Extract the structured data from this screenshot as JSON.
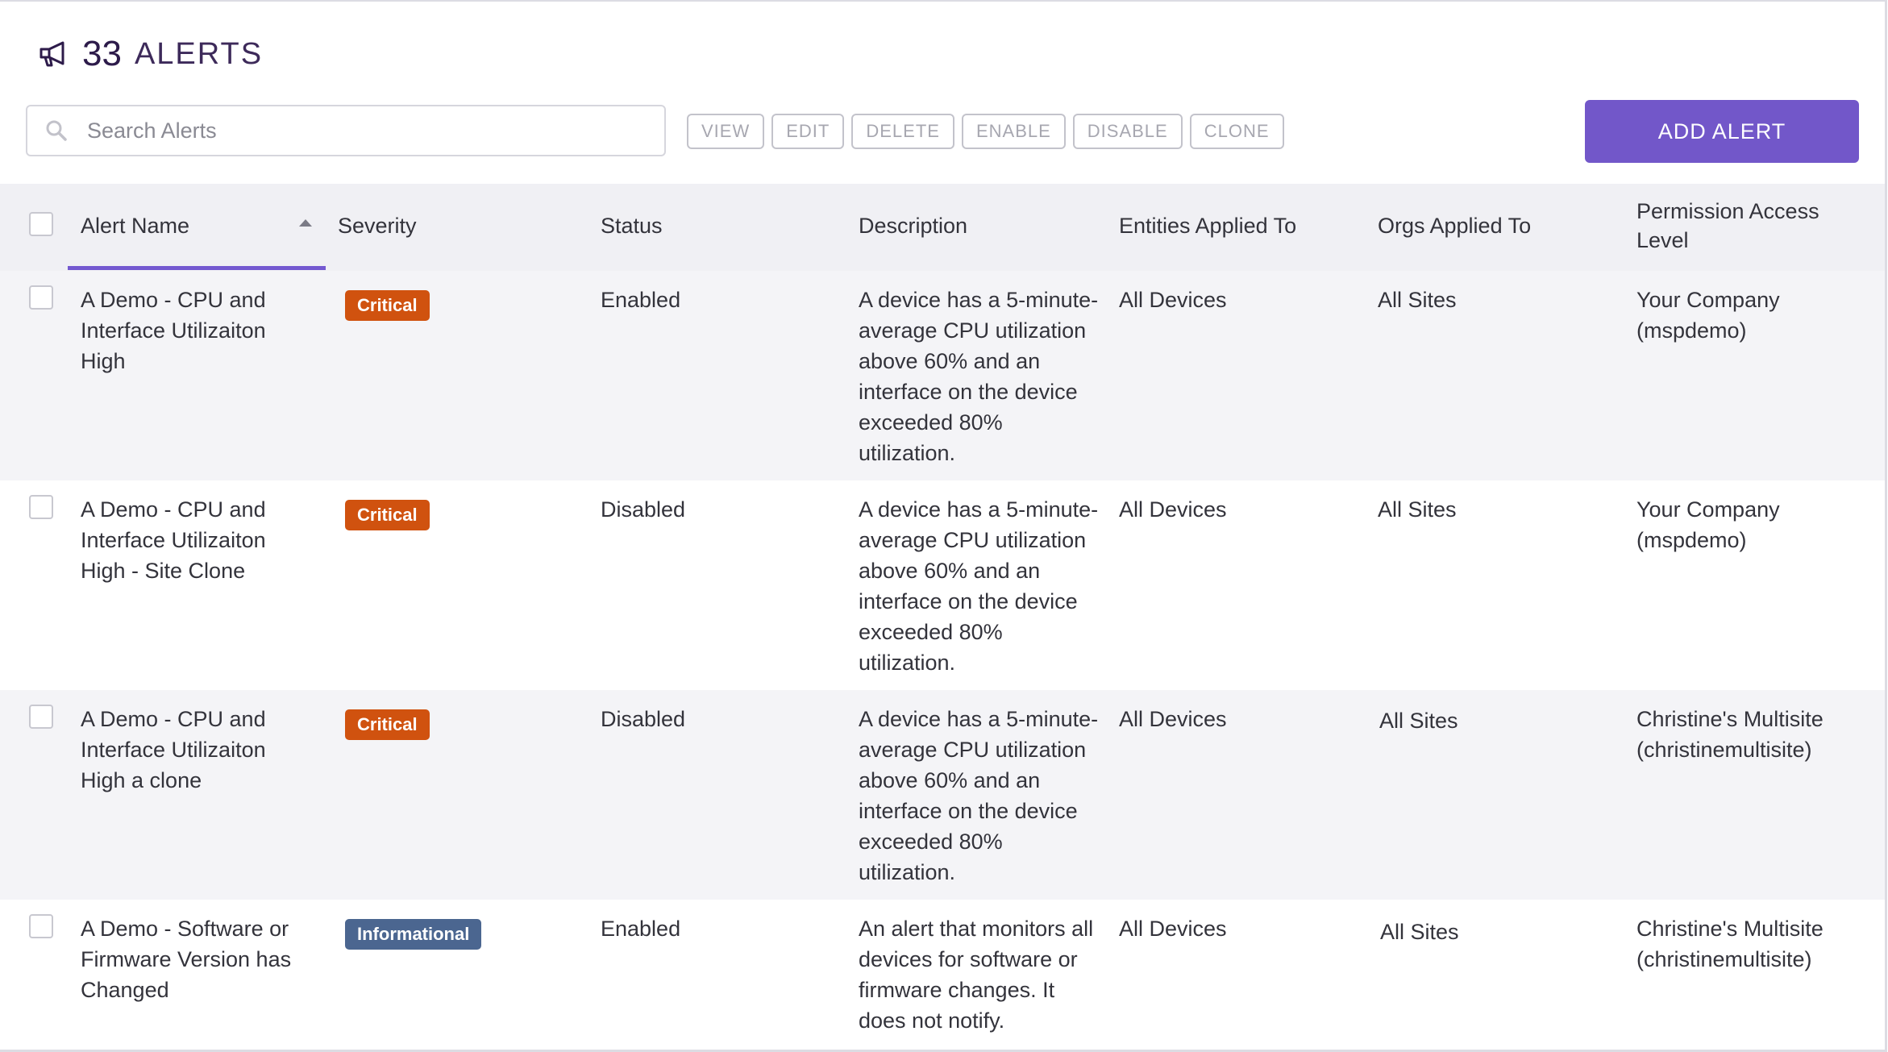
{
  "header": {
    "count": "33",
    "title": "ALERTS",
    "icon": "megaphone-icon"
  },
  "search": {
    "placeholder": "Search Alerts",
    "value": ""
  },
  "actions": {
    "view": "VIEW",
    "edit": "EDIT",
    "delete": "DELETE",
    "enable": "ENABLE",
    "disable": "DISABLE",
    "clone": "CLONE"
  },
  "add_button": "ADD ALERT",
  "colors": {
    "accent": "#7257c9",
    "critical": "#d0520f",
    "informational": "#4b6690"
  },
  "table": {
    "columns": {
      "name": "Alert Name",
      "severity": "Severity",
      "status": "Status",
      "description": "Description",
      "entities": "Entities Applied To",
      "orgs": "Orgs Applied To",
      "permission": "Permission Access Level"
    },
    "sort": {
      "column": "Alert Name",
      "direction": "ascending"
    },
    "rows": [
      {
        "name": "A Demo - CPU and Interface Utilizaiton High",
        "severity": "Critical",
        "status": "Enabled",
        "description": "A device has a 5-minute-average CPU utilization above 60% and an interface on the device exceeded 80% utilization.",
        "entities": "All Devices",
        "orgs": "All Sites",
        "permission": "Your Company (mspdemo)"
      },
      {
        "name": "A Demo - CPU and Interface Utilizaiton High - Site Clone",
        "severity": "Critical",
        "status": "Disabled",
        "description": "A device has a 5-minute-average CPU utilization above 60% and an interface on the device exceeded 80% utilization.",
        "entities": "All Devices",
        "orgs": "All Sites",
        "permission": "Your Company (mspdemo)"
      },
      {
        "name": "A Demo - CPU and Interface Utilizaiton High a clone",
        "severity": "Critical",
        "status": "Disabled",
        "description": "A device has a 5-minute-average CPU utilization above 60% and an interface on the device exceeded 80% utilization.",
        "entities": "All Devices",
        "orgs": "All Sites",
        "permission": "Christine's Multisite (christinemultisite)"
      },
      {
        "name": "A Demo - Software or Firmware Version has Changed",
        "severity": "Informational",
        "status": "Enabled",
        "description": "An alert that monitors all devices for software or firmware changes. It does not notify.",
        "entities": "All Devices",
        "orgs": "All Sites",
        "permission": "Christine's Multisite (christinemultisite)"
      }
    ]
  }
}
